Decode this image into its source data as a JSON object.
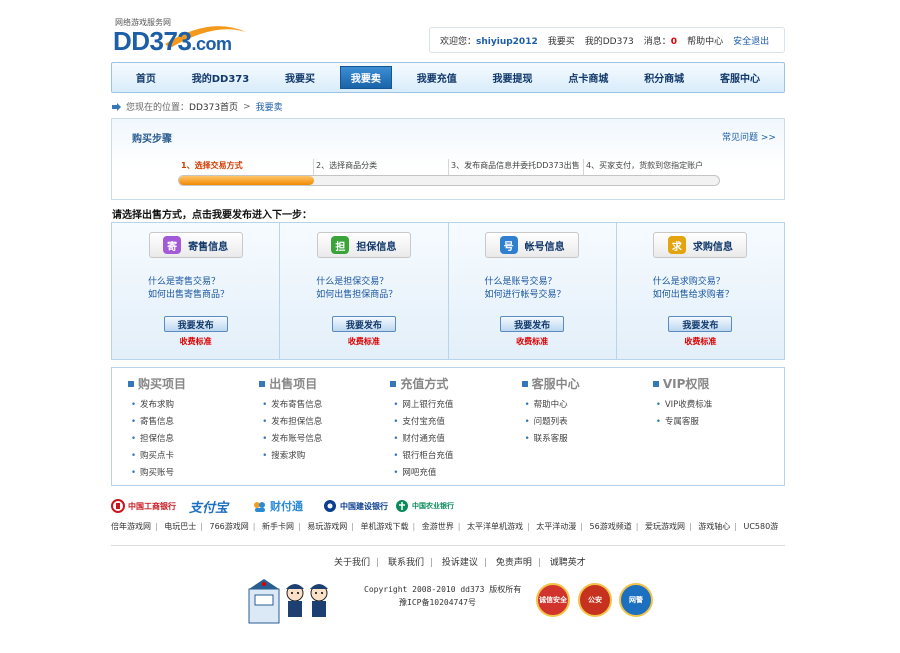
{
  "header": {
    "tagline": "网络游戏服务网",
    "logo_main": "DD373",
    "logo_suffix": ".com",
    "welcome": "欢迎您：",
    "username": "shiyiup2012",
    "links": [
      "我要买",
      "我的DD373"
    ],
    "messages_label": "消息：",
    "messages_count": "0",
    "help": "帮助中心",
    "logout": "安全退出"
  },
  "nav": {
    "items": [
      "首页",
      "我的DD373",
      "我要买",
      "我要卖",
      "我要充值",
      "我要提现",
      "点卡商城",
      "积分商城",
      "客服中心"
    ],
    "active_index": 3
  },
  "breadcrumb": {
    "prefix": "您现在的位置：",
    "home": "DD373首页",
    "separator": ">",
    "current": "我要卖"
  },
  "steps": {
    "title": "购买步骤",
    "faq": "常见问题 >>",
    "items": [
      "1、选择交易方式",
      "2、选择商品分类",
      "3、发布商品信息并委托DD373出售",
      "4、买家支付，货款到您指定账户"
    ],
    "current_step": 1,
    "progress_fraction": 0.25
  },
  "instruction": "请选择出售方式，点击我要发布进入下一步：",
  "cards": [
    {
      "title": "寄售信息",
      "icon": "consign-icon",
      "color": "#a35ad6",
      "q1": "什么是寄售交易？",
      "q2": "如何出售寄售商品？",
      "button": "我要发布",
      "fee": "收费标准"
    },
    {
      "title": "担保信息",
      "icon": "guarantee-icon",
      "color": "#3aa33a",
      "q1": "什么是担保交易？",
      "q2": "如何出售担保商品？",
      "button": "我要发布",
      "fee": "收费标准"
    },
    {
      "title": "帐号信息",
      "icon": "account-icon",
      "color": "#2f7fd0",
      "q1": "什么是账号交易？",
      "q2": "如何进行帐号交易？",
      "button": "我要发布",
      "fee": "收费标准"
    },
    {
      "title": "求购信息",
      "icon": "wanted-icon",
      "color": "#e3a40f",
      "q1": "什么是求购交易？",
      "q2": "如何出售给求购者？",
      "button": "我要发布",
      "fee": "收费标准"
    }
  ],
  "footer_columns": [
    {
      "title": "购买项目",
      "items": [
        "发布求购",
        "寄售信息",
        "担保信息",
        "购买点卡",
        "购买账号"
      ]
    },
    {
      "title": "出售项目",
      "items": [
        "发布寄售信息",
        "发布担保信息",
        "发布账号信息",
        "搜索求购"
      ]
    },
    {
      "title": "充值方式",
      "items": [
        "网上银行充值",
        "支付宝充值",
        "财付通充值",
        "银行柜台充值",
        "网吧充值"
      ]
    },
    {
      "title": "客服中心",
      "items": [
        "帮助中心",
        "问题列表",
        "联系客服"
      ]
    },
    {
      "title": "VIP权限",
      "items": [
        "VIP收费标准",
        "专属客服"
      ]
    }
  ],
  "banks": [
    {
      "name": "中国工商银行",
      "color": "#c8161d"
    },
    {
      "name": "支付宝",
      "color": "#1d6fc0"
    },
    {
      "name": "财付通",
      "color": "#2a8ad6"
    },
    {
      "name": "中国建设银行",
      "color": "#0a3d91"
    },
    {
      "name": "中国农业银行",
      "color": "#0a8a5a"
    }
  ],
  "friend_links": [
    "倍年游戏网",
    "电玩巴士",
    "766游戏网",
    "新手卡网",
    "易玩游戏网",
    "单机游戏下载",
    "金游世界",
    "太平洋单机游戏",
    "太平洋动漫",
    "56游戏频道",
    "爱玩游戏网",
    "游戏轴心",
    "UC580游"
  ],
  "bottom_links": [
    "关于我们",
    "联系我们",
    "投诉建议",
    "免责声明",
    "诚聘英才"
  ],
  "copyright": {
    "line1": "Copyright 2008-2010 dd373 版权所有",
    "line2": "豫ICP备10204747号"
  },
  "badges": [
    {
      "label": "诚信安全",
      "color": "#d0342c"
    },
    {
      "label": "公安",
      "color": "#c6321e"
    },
    {
      "label": "网警",
      "color": "#1d6fc0"
    }
  ],
  "colors": {
    "brand": "#1d5ea8",
    "accent": "#f08a00",
    "nav_active": "#1a63a8"
  }
}
